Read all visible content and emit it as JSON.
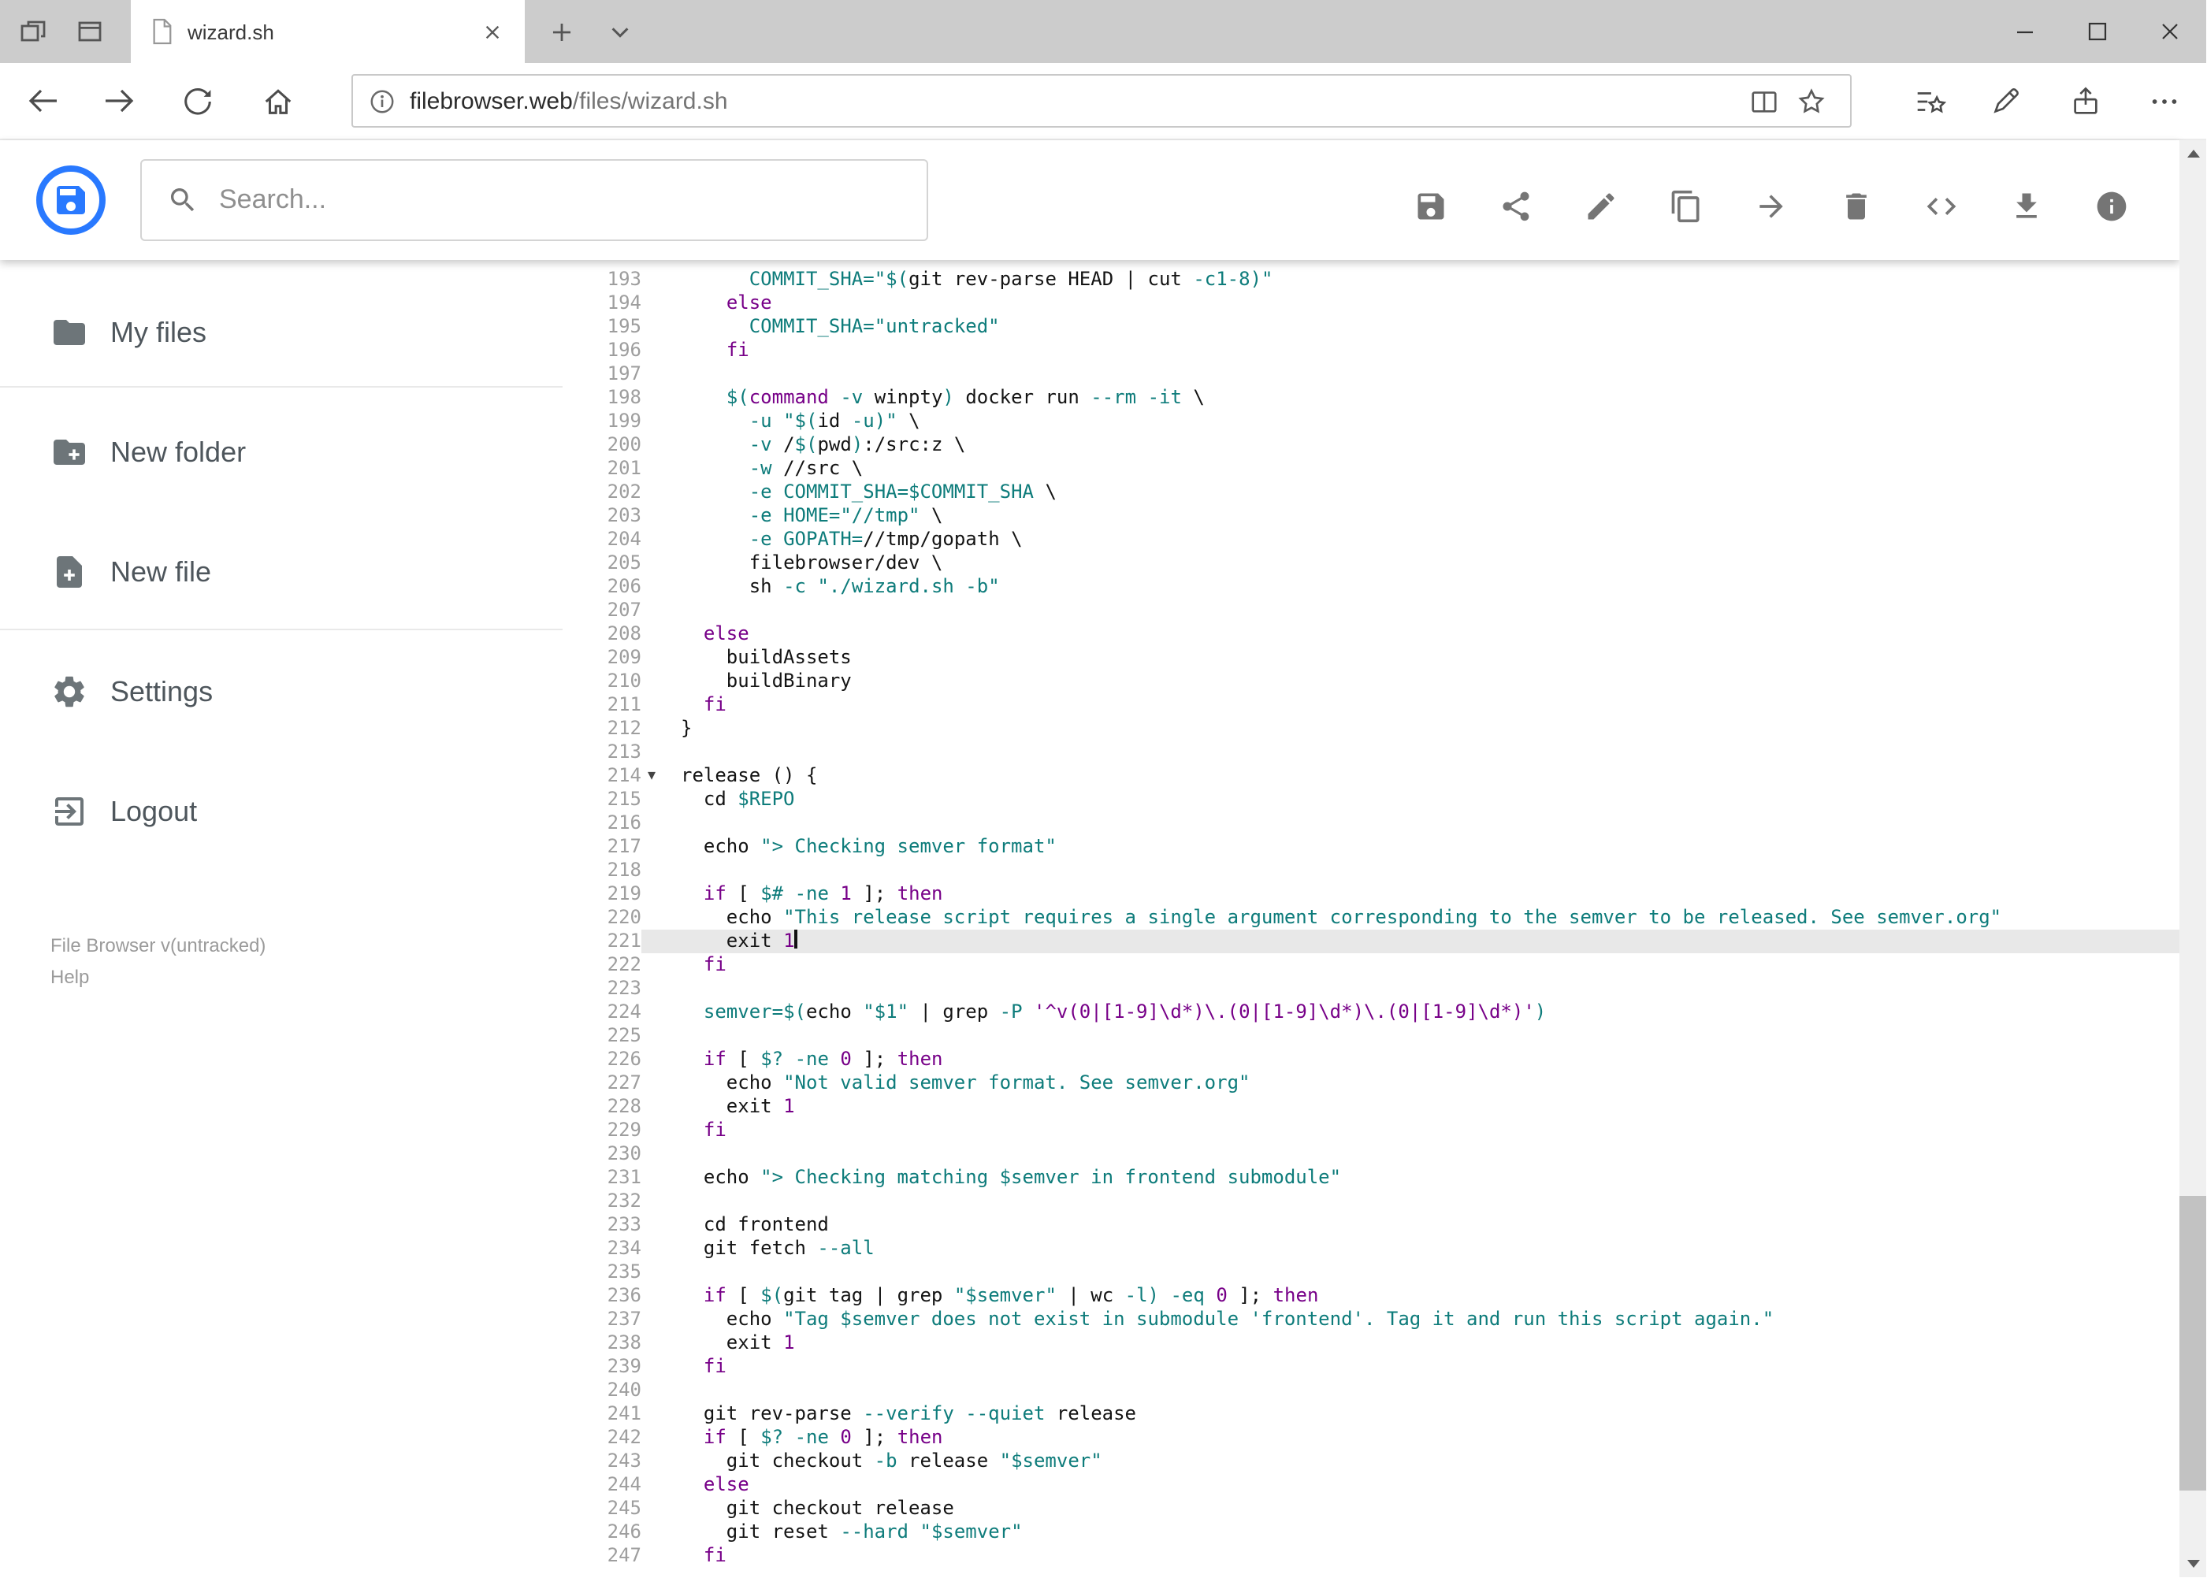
{
  "browser": {
    "tab_title": "wizard.sh",
    "url_host": "filebrowser.web",
    "url_path": "/files/wizard.sh"
  },
  "header": {
    "search_placeholder": "Search..."
  },
  "toolbar": {
    "buttons": [
      "save",
      "share",
      "edit",
      "copy",
      "move",
      "delete",
      "code",
      "download",
      "info"
    ]
  },
  "sidebar": {
    "items": [
      {
        "label": "My files"
      },
      {
        "label": "New folder"
      },
      {
        "label": "New file"
      },
      {
        "label": "Settings"
      },
      {
        "label": "Logout"
      }
    ],
    "version": "File Browser v(untracked)",
    "help": "Help"
  },
  "colors": {
    "accent_blue": "#2979ff",
    "keyword_purple": "#770088",
    "string_teal": "#0e7c7b",
    "active_line_bg": "#e8e8e8",
    "icon_gray": "#757575"
  },
  "editor": {
    "active_line": 221,
    "fold_marker_line": 214,
    "lines": [
      [
        193,
        [
          [
            "      ",
            "p"
          ],
          [
            "COMMIT_SHA=",
            "t"
          ],
          [
            "\"$(",
            "t"
          ],
          [
            "git rev-parse HEAD | cut ",
            "p"
          ],
          [
            "-c1-8",
            "t"
          ],
          [
            ")\"",
            "t"
          ]
        ]
      ],
      [
        194,
        [
          [
            "    ",
            "p"
          ],
          [
            "else",
            "k"
          ]
        ]
      ],
      [
        195,
        [
          [
            "      ",
            "p"
          ],
          [
            "COMMIT_SHA=",
            "t"
          ],
          [
            "\"untracked\"",
            "t"
          ]
        ]
      ],
      [
        196,
        [
          [
            "    ",
            "p"
          ],
          [
            "fi",
            "k"
          ]
        ]
      ],
      [
        197,
        []
      ],
      [
        198,
        [
          [
            "    ",
            "p"
          ],
          [
            "$(",
            "t"
          ],
          [
            "command",
            "k"
          ],
          [
            " ",
            "p"
          ],
          [
            "-v",
            "t"
          ],
          [
            " winpty",
            "p"
          ],
          [
            ")",
            "t"
          ],
          [
            " docker run ",
            "p"
          ],
          [
            "--rm",
            "t"
          ],
          [
            " ",
            "p"
          ],
          [
            "-it",
            "t"
          ],
          [
            " \\",
            "p"
          ]
        ]
      ],
      [
        199,
        [
          [
            "      ",
            "p"
          ],
          [
            "-u",
            "t"
          ],
          [
            " ",
            "p"
          ],
          [
            "\"$(",
            "t"
          ],
          [
            "id ",
            "p"
          ],
          [
            "-u",
            "t"
          ],
          [
            ")\"",
            "t"
          ],
          [
            " \\",
            "p"
          ]
        ]
      ],
      [
        200,
        [
          [
            "      ",
            "p"
          ],
          [
            "-v",
            "t"
          ],
          [
            " /",
            "p"
          ],
          [
            "$(",
            "t"
          ],
          [
            "pwd",
            "p"
          ],
          [
            ")",
            "t"
          ],
          [
            ":/src:z \\",
            "p"
          ]
        ]
      ],
      [
        201,
        [
          [
            "      ",
            "p"
          ],
          [
            "-w",
            "t"
          ],
          [
            " //src \\",
            "p"
          ]
        ]
      ],
      [
        202,
        [
          [
            "      ",
            "p"
          ],
          [
            "-e",
            "t"
          ],
          [
            " ",
            "p"
          ],
          [
            "COMMIT_SHA=$COMMIT_SHA",
            "t"
          ],
          [
            " \\",
            "p"
          ]
        ]
      ],
      [
        203,
        [
          [
            "      ",
            "p"
          ],
          [
            "-e",
            "t"
          ],
          [
            " ",
            "p"
          ],
          [
            "HOME=",
            "t"
          ],
          [
            "\"//tmp\"",
            "t"
          ],
          [
            " \\",
            "p"
          ]
        ]
      ],
      [
        204,
        [
          [
            "      ",
            "p"
          ],
          [
            "-e",
            "t"
          ],
          [
            " ",
            "p"
          ],
          [
            "GOPATH=",
            "t"
          ],
          [
            "//tmp/gopath \\",
            "p"
          ]
        ]
      ],
      [
        205,
        [
          [
            "      ",
            "p"
          ],
          [
            "filebrowser/dev \\",
            "p"
          ]
        ]
      ],
      [
        206,
        [
          [
            "      ",
            "p"
          ],
          [
            "sh ",
            "p"
          ],
          [
            "-c",
            "t"
          ],
          [
            " ",
            "p"
          ],
          [
            "\"./wizard.sh -b\"",
            "t"
          ]
        ]
      ],
      [
        207,
        []
      ],
      [
        208,
        [
          [
            "  ",
            "p"
          ],
          [
            "else",
            "k"
          ]
        ]
      ],
      [
        209,
        [
          [
            "    buildAssets",
            "p"
          ]
        ]
      ],
      [
        210,
        [
          [
            "    buildBinary",
            "p"
          ]
        ]
      ],
      [
        211,
        [
          [
            "  ",
            "p"
          ],
          [
            "fi",
            "k"
          ]
        ]
      ],
      [
        212,
        [
          [
            "}",
            "p"
          ]
        ]
      ],
      [
        213,
        []
      ],
      [
        214,
        [
          [
            "release () {",
            "p"
          ]
        ],
        "f"
      ],
      [
        215,
        [
          [
            "  cd ",
            "p"
          ],
          [
            "$REPO",
            "t"
          ]
        ]
      ],
      [
        216,
        []
      ],
      [
        217,
        [
          [
            "  echo ",
            "p"
          ],
          [
            "\"> Checking semver format\"",
            "t"
          ]
        ]
      ],
      [
        218,
        []
      ],
      [
        219,
        [
          [
            "  ",
            "p"
          ],
          [
            "if",
            "k"
          ],
          [
            " [ ",
            "p"
          ],
          [
            "$#",
            "t"
          ],
          [
            " ",
            "p"
          ],
          [
            "-ne",
            "t"
          ],
          [
            " ",
            "p"
          ],
          [
            "1",
            "k"
          ],
          [
            " ]; ",
            "p"
          ],
          [
            "then",
            "k"
          ]
        ]
      ],
      [
        220,
        [
          [
            "    echo ",
            "p"
          ],
          [
            "\"This release script requires a single argument corresponding to the semver to be released. See semver.org\"",
            "t"
          ]
        ]
      ],
      [
        221,
        [
          [
            "    exit ",
            "p"
          ],
          [
            "1",
            "k"
          ]
        ],
        "a"
      ],
      [
        222,
        [
          [
            "  ",
            "p"
          ],
          [
            "fi",
            "k"
          ]
        ]
      ],
      [
        223,
        []
      ],
      [
        224,
        [
          [
            "  ",
            "p"
          ],
          [
            "semver=",
            "t"
          ],
          [
            "$(",
            "t"
          ],
          [
            "echo ",
            "p"
          ],
          [
            "\"$1\"",
            "t"
          ],
          [
            " | grep ",
            "p"
          ],
          [
            "-P",
            "t"
          ],
          [
            " ",
            "p"
          ],
          [
            "'^v(0|[1-9]\\d*)\\.(0|[1-9]\\d*)\\.(0|[1-9]\\d*)'",
            "k"
          ],
          [
            ")",
            "t"
          ]
        ]
      ],
      [
        225,
        []
      ],
      [
        226,
        [
          [
            "  ",
            "p"
          ],
          [
            "if",
            "k"
          ],
          [
            " [ ",
            "p"
          ],
          [
            "$?",
            "t"
          ],
          [
            " ",
            "p"
          ],
          [
            "-ne",
            "t"
          ],
          [
            " ",
            "p"
          ],
          [
            "0",
            "k"
          ],
          [
            " ]; ",
            "p"
          ],
          [
            "then",
            "k"
          ]
        ]
      ],
      [
        227,
        [
          [
            "    echo ",
            "p"
          ],
          [
            "\"Not valid semver format. See semver.org\"",
            "t"
          ]
        ]
      ],
      [
        228,
        [
          [
            "    exit ",
            "p"
          ],
          [
            "1",
            "k"
          ]
        ]
      ],
      [
        229,
        [
          [
            "  ",
            "p"
          ],
          [
            "fi",
            "k"
          ]
        ]
      ],
      [
        230,
        []
      ],
      [
        231,
        [
          [
            "  echo ",
            "p"
          ],
          [
            "\"> Checking matching $semver in frontend submodule\"",
            "t"
          ]
        ]
      ],
      [
        232,
        []
      ],
      [
        233,
        [
          [
            "  cd frontend",
            "p"
          ]
        ]
      ],
      [
        234,
        [
          [
            "  git fetch ",
            "p"
          ],
          [
            "--all",
            "t"
          ]
        ]
      ],
      [
        235,
        []
      ],
      [
        236,
        [
          [
            "  ",
            "p"
          ],
          [
            "if",
            "k"
          ],
          [
            " [ ",
            "p"
          ],
          [
            "$(",
            "t"
          ],
          [
            "git tag | grep ",
            "p"
          ],
          [
            "\"$semver\"",
            "t"
          ],
          [
            " | wc ",
            "p"
          ],
          [
            "-l",
            "t"
          ],
          [
            ")",
            "t"
          ],
          [
            " ",
            "p"
          ],
          [
            "-eq",
            "t"
          ],
          [
            " ",
            "p"
          ],
          [
            "0",
            "k"
          ],
          [
            " ]; ",
            "p"
          ],
          [
            "then",
            "k"
          ]
        ]
      ],
      [
        237,
        [
          [
            "    echo ",
            "p"
          ],
          [
            "\"Tag $semver does not exist in submodule 'frontend'. Tag it and run this script again.\"",
            "t"
          ]
        ]
      ],
      [
        238,
        [
          [
            "    exit ",
            "p"
          ],
          [
            "1",
            "k"
          ]
        ]
      ],
      [
        239,
        [
          [
            "  ",
            "p"
          ],
          [
            "fi",
            "k"
          ]
        ]
      ],
      [
        240,
        []
      ],
      [
        241,
        [
          [
            "  git rev-parse ",
            "p"
          ],
          [
            "--verify",
            "t"
          ],
          [
            " ",
            "p"
          ],
          [
            "--quiet",
            "t"
          ],
          [
            " release",
            "p"
          ]
        ]
      ],
      [
        242,
        [
          [
            "  ",
            "p"
          ],
          [
            "if",
            "k"
          ],
          [
            " [ ",
            "p"
          ],
          [
            "$?",
            "t"
          ],
          [
            " ",
            "p"
          ],
          [
            "-ne",
            "t"
          ],
          [
            " ",
            "p"
          ],
          [
            "0",
            "k"
          ],
          [
            " ]; ",
            "p"
          ],
          [
            "then",
            "k"
          ]
        ]
      ],
      [
        243,
        [
          [
            "    git checkout ",
            "p"
          ],
          [
            "-b",
            "t"
          ],
          [
            " release ",
            "p"
          ],
          [
            "\"$semver\"",
            "t"
          ]
        ]
      ],
      [
        244,
        [
          [
            "  ",
            "p"
          ],
          [
            "else",
            "k"
          ]
        ]
      ],
      [
        245,
        [
          [
            "    git checkout release",
            "p"
          ]
        ]
      ],
      [
        246,
        [
          [
            "    git reset ",
            "p"
          ],
          [
            "--hard",
            "t"
          ],
          [
            " ",
            "p"
          ],
          [
            "\"$semver\"",
            "t"
          ]
        ]
      ],
      [
        247,
        [
          [
            "  ",
            "p"
          ],
          [
            "fi",
            "k"
          ]
        ]
      ]
    ]
  }
}
